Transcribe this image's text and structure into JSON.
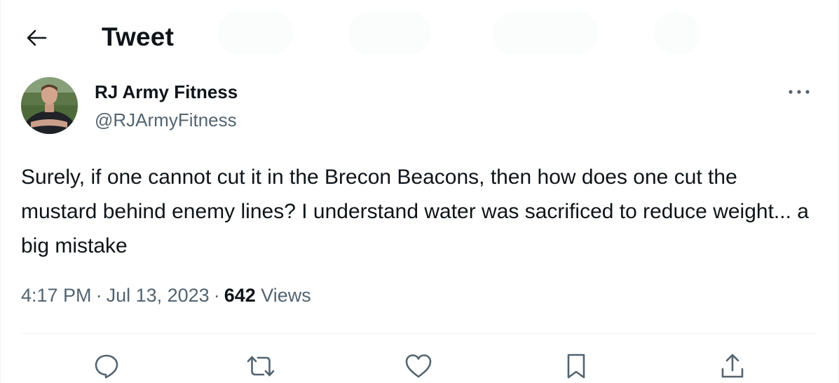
{
  "header": {
    "title": "Tweet",
    "back_icon": "arrow-left-icon"
  },
  "tweet": {
    "author": {
      "name": "RJ Army Fitness",
      "handle": "@RJArmyFitness"
    },
    "text": "Surely, if one cannot cut it in the Brecon Beacons, then how does one cut the mustard behind enemy lines? I understand water was sacrificed to reduce weight... a big mistake",
    "time": "4:17 PM",
    "date": "Jul 13, 2023",
    "separator": "·",
    "views_count": "642",
    "views_label": "Views"
  },
  "actions": [
    "reply-icon",
    "retweet-icon",
    "like-icon",
    "bookmark-icon",
    "share-icon"
  ],
  "colors": {
    "text": "#0f1419",
    "secondary": "#536471",
    "divider": "#eff3f4"
  }
}
